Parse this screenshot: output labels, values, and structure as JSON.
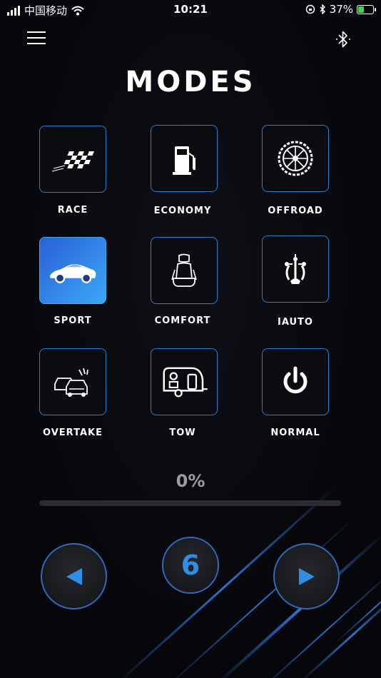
{
  "status_bar": {
    "carrier": "中国移动",
    "time": "10:21",
    "battery_percent": "37%",
    "battery_level": 0.37
  },
  "header": {
    "title": "MODES",
    "menu_icon": "hamburger-icon",
    "bluetooth_icon": "bluetooth-icon"
  },
  "modes": [
    {
      "label": "RACE",
      "icon": "checkered-flag-icon",
      "active": false
    },
    {
      "label": "ECONOMY",
      "icon": "fuel-pump-icon",
      "active": false
    },
    {
      "label": "OFFROAD",
      "icon": "tire-icon",
      "active": false
    },
    {
      "label": "SPORT",
      "icon": "sports-car-icon",
      "active": true
    },
    {
      "label": "COMFORT",
      "icon": "car-seat-icon",
      "active": false
    },
    {
      "label": "IAUTO",
      "icon": "circuit-tree-icon",
      "active": false
    },
    {
      "label": "OVERTAKE",
      "icon": "overtaking-cars-icon",
      "active": false
    },
    {
      "label": "TOW",
      "icon": "camper-trailer-icon",
      "active": false
    },
    {
      "label": "NORMAL",
      "icon": "power-icon",
      "active": false
    }
  ],
  "progress": {
    "percent_label": "0%",
    "value": 0
  },
  "controls": {
    "level": "6",
    "prev_icon": "triangle-left-icon",
    "next_icon": "triangle-right-icon"
  },
  "colors": {
    "accent": "#3aa8f5",
    "tile_border": "#2a7fd0",
    "active_gradient_start": "#2a5fd8",
    "active_gradient_end": "#3aa8f5",
    "level_number": "#2f8fe6",
    "progress_label": "#9a9ca3"
  }
}
